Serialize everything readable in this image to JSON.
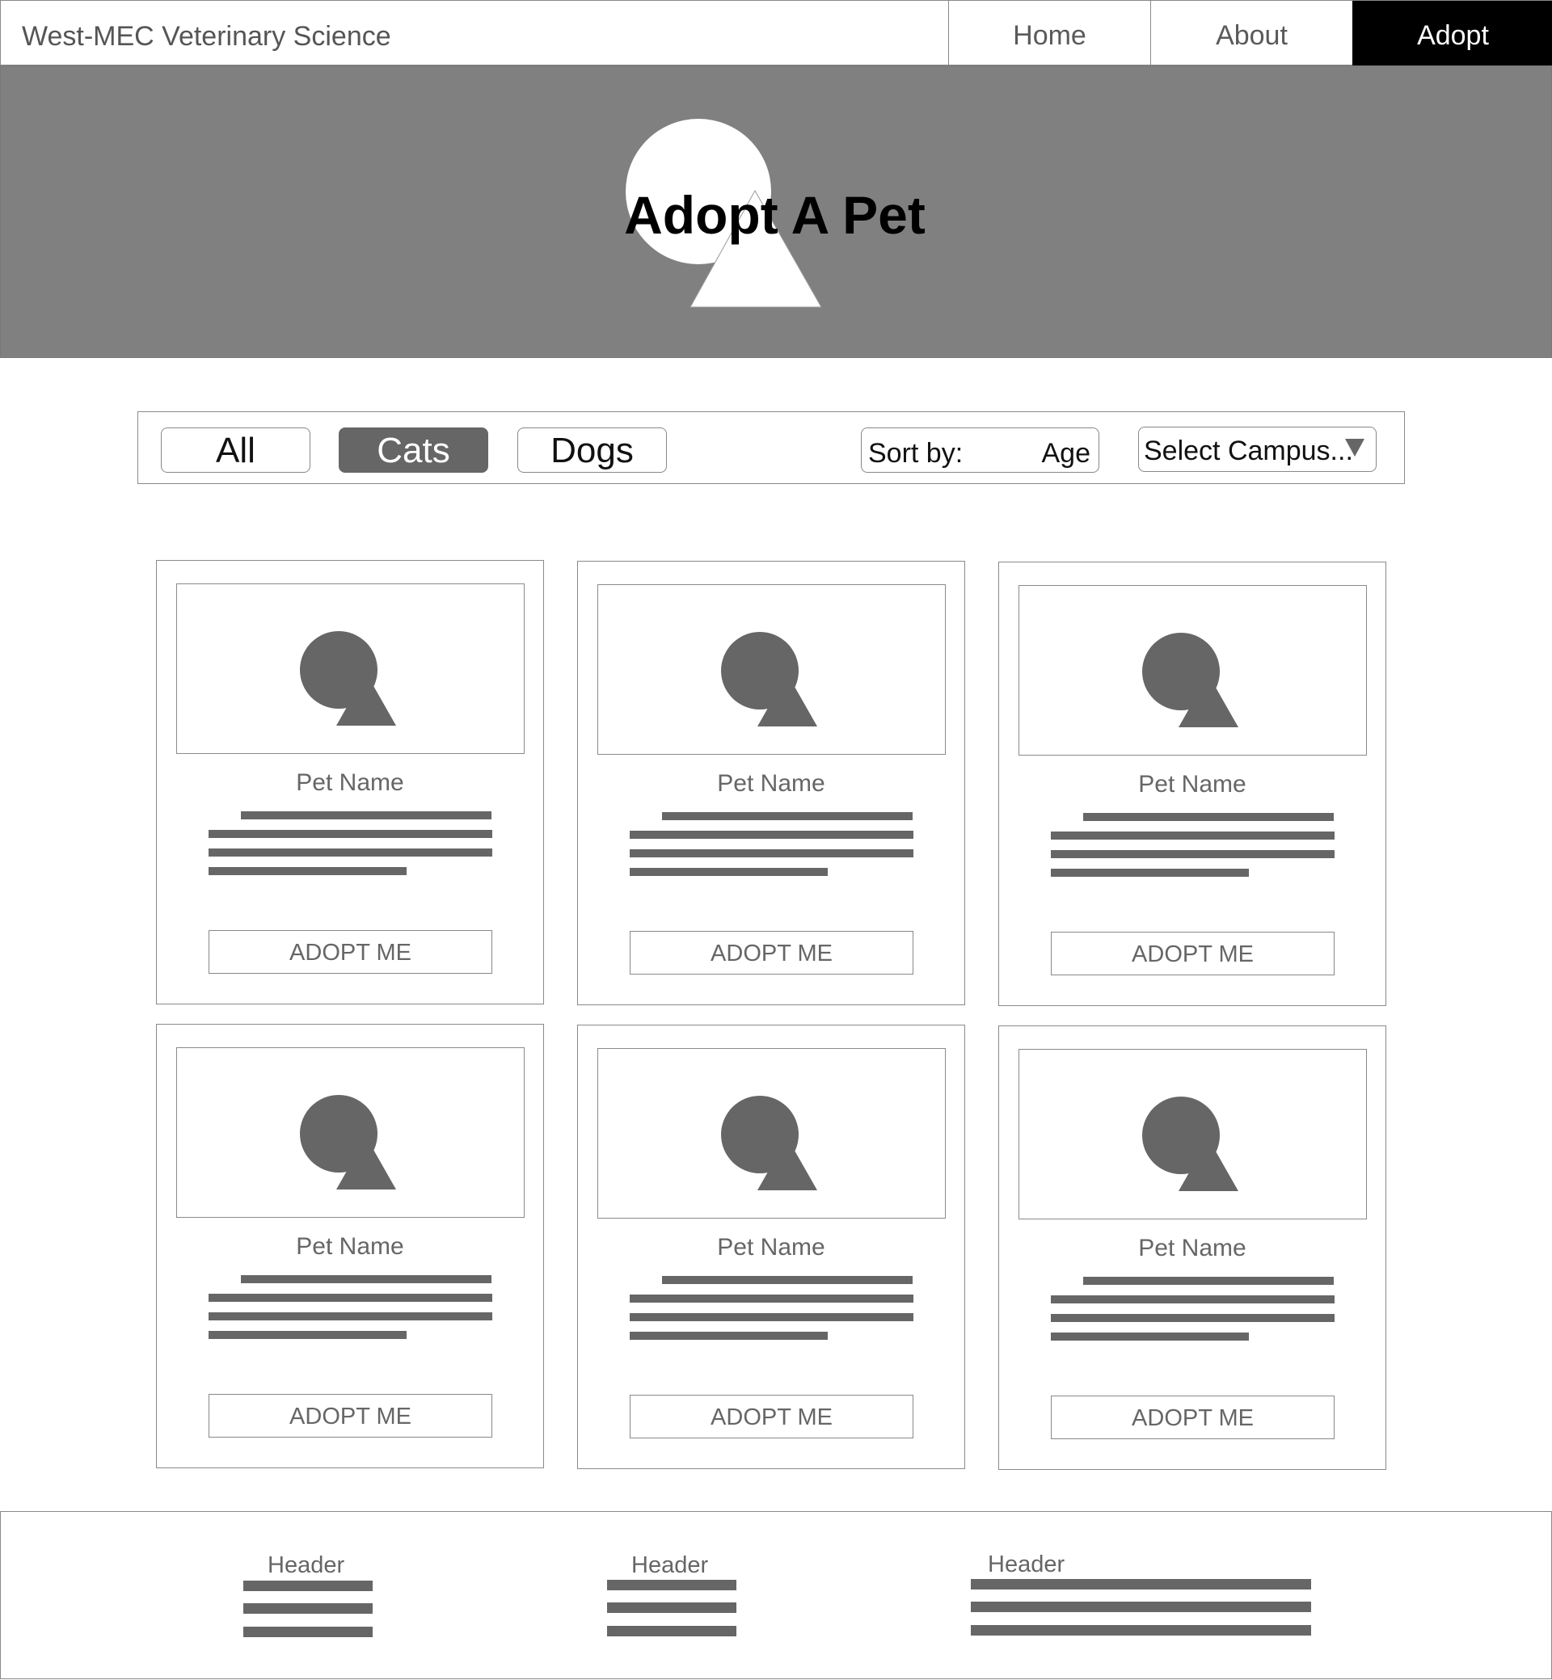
{
  "nav": {
    "brand": "West-MEC Veterinary Science",
    "tabs": [
      {
        "label": "Home"
      },
      {
        "label": "About"
      },
      {
        "label": "Adopt"
      }
    ]
  },
  "hero": {
    "title": "Adopt A Pet",
    "image_icon": "image-placeholder-icon"
  },
  "filters": {
    "buttons": [
      {
        "label": "All",
        "active": false
      },
      {
        "label": "Cats",
        "active": true
      },
      {
        "label": "Dogs",
        "active": false
      }
    ],
    "sort_label": "Sort by:",
    "sort_value": "Age",
    "campus_label": "Select Campus...",
    "campus_icon": "dropdown-arrow-icon"
  },
  "cards": [
    {
      "name": "Pet Name",
      "button": "ADOPT ME"
    },
    {
      "name": "Pet Name",
      "button": "ADOPT ME"
    },
    {
      "name": "Pet Name",
      "button": "ADOPT ME"
    },
    {
      "name": "Pet Name",
      "button": "ADOPT ME"
    },
    {
      "name": "Pet Name",
      "button": "ADOPT ME"
    },
    {
      "name": "Pet Name",
      "button": "ADOPT ME"
    }
  ],
  "footer": {
    "columns": [
      {
        "header": "Header"
      },
      {
        "header": "Header"
      },
      {
        "header": "Header"
      }
    ]
  },
  "colors": {
    "hero_bg": "#808080",
    "active_tab": "#000000",
    "active_filter": "#666666",
    "placeholder_gray": "#666666"
  }
}
